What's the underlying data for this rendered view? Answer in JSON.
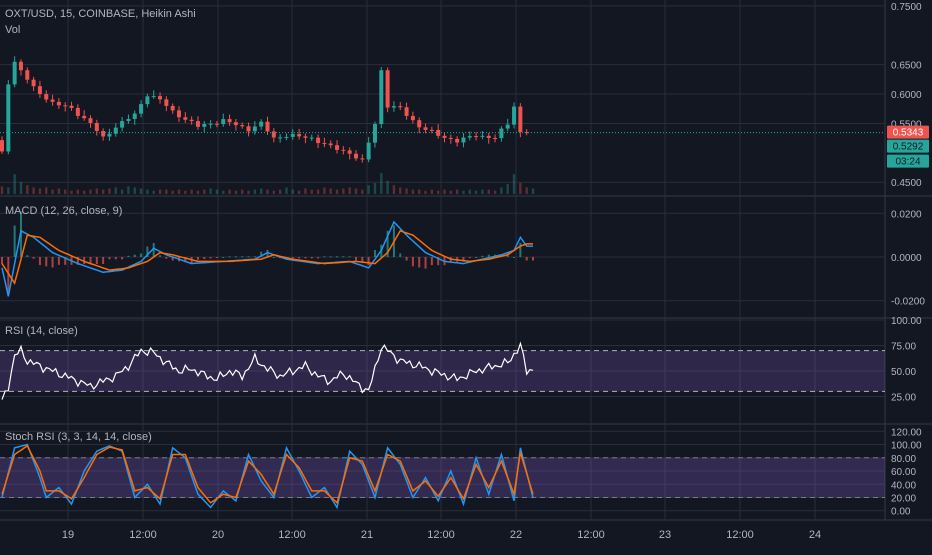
{
  "header": {
    "symbol": "OXT/USD",
    "interval": "15",
    "exchange": "COINBASE",
    "chart_style": "Heikin Ashi",
    "volume_label": "Vol"
  },
  "time_axis": {
    "labels": [
      "19",
      "12:00",
      "20",
      "12:00",
      "21",
      "12:00",
      "22",
      "12:00",
      "23",
      "12:00",
      "24"
    ]
  },
  "price_badges": {
    "last_price": "0.5343",
    "open_price": "0.5292",
    "countdown": "03:24"
  },
  "colors": {
    "background": "#131722",
    "grid": "#2a2e39",
    "up": "#26a69a",
    "down": "#ef5350",
    "macd_line": "#2196f3",
    "signal_line": "#ff6d00",
    "rsi_line": "#ffffff",
    "rsi_band": "#7e57c2",
    "stoch_k": "#2196f3",
    "stoch_d": "#ff6d00"
  },
  "chart_data": [
    {
      "type": "candlestick",
      "title": "OXT/USD, 15, COINBASE, Heikin Ashi",
      "ylim": [
        0.43,
        0.76
      ],
      "y_ticks": [
        "0.7500",
        "0.6500",
        "0.6000",
        "0.5500",
        "0.4500"
      ],
      "last_price": 0.5343,
      "price_path": [
        [
          0,
          0.52
        ],
        [
          1,
          0.5
        ],
        [
          2,
          0.62
        ],
        [
          3,
          0.655
        ],
        [
          4,
          0.64
        ],
        [
          6,
          0.61
        ],
        [
          9,
          0.585
        ],
        [
          12,
          0.575
        ],
        [
          15,
          0.55
        ],
        [
          17,
          0.525
        ],
        [
          19,
          0.545
        ],
        [
          22,
          0.565
        ],
        [
          24,
          0.6
        ],
        [
          26,
          0.59
        ],
        [
          28,
          0.57
        ],
        [
          32,
          0.545
        ],
        [
          36,
          0.555
        ],
        [
          40,
          0.54
        ],
        [
          42,
          0.55
        ],
        [
          44,
          0.525
        ],
        [
          46,
          0.53
        ],
        [
          50,
          0.525
        ],
        [
          53,
          0.51
        ],
        [
          56,
          0.5
        ],
        [
          58,
          0.485
        ],
        [
          60,
          0.55
        ],
        [
          61,
          0.64
        ],
        [
          62,
          0.58
        ],
        [
          64,
          0.575
        ],
        [
          67,
          0.545
        ],
        [
          70,
          0.53
        ],
        [
          73,
          0.52
        ],
        [
          76,
          0.53
        ],
        [
          79,
          0.525
        ],
        [
          81,
          0.55
        ],
        [
          82,
          0.58
        ],
        [
          83,
          0.535
        ],
        [
          84,
          0.537
        ]
      ],
      "volume": [
        0.35,
        0.3,
        0.9,
        0.55,
        0.4,
        0.3,
        0.25,
        0.3,
        0.2,
        0.25,
        0.2,
        0.15,
        0.2,
        0.15,
        0.2,
        0.25,
        0.2,
        0.25,
        0.3,
        0.2,
        0.35,
        0.3,
        0.25,
        0.2,
        0.15,
        0.2,
        0.2,
        0.15,
        0.2,
        0.15,
        0.2,
        0.15,
        0.2,
        0.25,
        0.2,
        0.15,
        0.2,
        0.15,
        0.2,
        0.15,
        0.2,
        0.25,
        0.2,
        0.15,
        0.2,
        0.3,
        0.2,
        0.15,
        0.25,
        0.2,
        0.2,
        0.3,
        0.25,
        0.2,
        0.25,
        0.3,
        0.25,
        0.2,
        0.4,
        0.5,
        0.95,
        0.6,
        0.4,
        0.3,
        0.25,
        0.2,
        0.2,
        0.15,
        0.2,
        0.15,
        0.2,
        0.15,
        0.2,
        0.15,
        0.2,
        0.15,
        0.2,
        0.2,
        0.15,
        0.3,
        0.45,
        0.9,
        0.5,
        0.3,
        0.25
      ]
    },
    {
      "type": "line",
      "title": "MACD (12, 26, close, 9)",
      "ylim": [
        -0.027,
        0.027
      ],
      "y_ticks": [
        "0.0200",
        "0.0000",
        "-0.0200"
      ],
      "series": [
        {
          "key": "macd",
          "points": [
            [
              0,
              -0.005
            ],
            [
              1,
              -0.018
            ],
            [
              3,
              0.012
            ],
            [
              5,
              0.009
            ],
            [
              8,
              0.002
            ],
            [
              12,
              -0.003
            ],
            [
              16,
              -0.007
            ],
            [
              19,
              -0.006
            ],
            [
              22,
              -0.002
            ],
            [
              24,
              0.004
            ],
            [
              26,
              0.001
            ],
            [
              30,
              -0.003
            ],
            [
              35,
              -0.002
            ],
            [
              40,
              -0.001
            ],
            [
              42,
              0.002
            ],
            [
              45,
              -0.001
            ],
            [
              50,
              -0.003
            ],
            [
              55,
              -0.002
            ],
            [
              58,
              -0.005
            ],
            [
              60,
              0.003
            ],
            [
              62,
              0.016
            ],
            [
              64,
              0.01
            ],
            [
              67,
              0.002
            ],
            [
              70,
              -0.002
            ],
            [
              73,
              -0.003
            ],
            [
              76,
              -0.001
            ],
            [
              79,
              0.001
            ],
            [
              81,
              0.003
            ],
            [
              82,
              0.009
            ],
            [
              83,
              0.005
            ],
            [
              84,
              0.005
            ]
          ]
        },
        {
          "key": "signal",
          "points": [
            [
              0,
              -0.003
            ],
            [
              2,
              -0.012
            ],
            [
              4,
              0.01
            ],
            [
              6,
              0.009
            ],
            [
              9,
              0.003
            ],
            [
              13,
              -0.002
            ],
            [
              17,
              -0.006
            ],
            [
              20,
              -0.005
            ],
            [
              23,
              -0.002
            ],
            [
              25,
              0.002
            ],
            [
              27,
              0.001
            ],
            [
              31,
              -0.002
            ],
            [
              36,
              -0.002
            ],
            [
              41,
              -0.001
            ],
            [
              43,
              0.001
            ],
            [
              46,
              -0.001
            ],
            [
              51,
              -0.003
            ],
            [
              56,
              -0.002
            ],
            [
              59,
              -0.003
            ],
            [
              61,
              0.002
            ],
            [
              63,
              0.012
            ],
            [
              65,
              0.01
            ],
            [
              68,
              0.003
            ],
            [
              71,
              -0.001
            ],
            [
              74,
              -0.002
            ],
            [
              77,
              -0.001
            ],
            [
              80,
              0.001
            ],
            [
              82,
              0.005
            ],
            [
              83,
              0.006
            ],
            [
              84,
              0.006
            ]
          ]
        }
      ]
    },
    {
      "type": "line",
      "title": "RSI (14, close)",
      "ylim": [
        0,
        100
      ],
      "y_ticks": [
        "100.00",
        "75.00",
        "50.00",
        "25.00"
      ],
      "band": [
        30,
        70
      ],
      "points": [
        [
          0,
          20
        ],
        [
          1,
          35
        ],
        [
          2,
          65
        ],
        [
          3,
          70
        ],
        [
          4,
          60
        ],
        [
          6,
          55
        ],
        [
          8,
          50
        ],
        [
          10,
          45
        ],
        [
          12,
          40
        ],
        [
          14,
          35
        ],
        [
          16,
          40
        ],
        [
          18,
          45
        ],
        [
          20,
          55
        ],
        [
          22,
          70
        ],
        [
          24,
          68
        ],
        [
          26,
          58
        ],
        [
          28,
          50
        ],
        [
          30,
          52
        ],
        [
          32,
          46
        ],
        [
          34,
          42
        ],
        [
          36,
          50
        ],
        [
          38,
          45
        ],
        [
          40,
          62
        ],
        [
          42,
          52
        ],
        [
          44,
          45
        ],
        [
          46,
          50
        ],
        [
          48,
          55
        ],
        [
          50,
          45
        ],
        [
          52,
          40
        ],
        [
          54,
          48
        ],
        [
          56,
          38
        ],
        [
          58,
          30
        ],
        [
          60,
          74
        ],
        [
          61,
          70
        ],
        [
          63,
          60
        ],
        [
          66,
          55
        ],
        [
          69,
          48
        ],
        [
          72,
          42
        ],
        [
          75,
          50
        ],
        [
          78,
          55
        ],
        [
          80,
          58
        ],
        [
          82,
          75
        ],
        [
          83,
          50
        ],
        [
          84,
          52
        ]
      ]
    },
    {
      "type": "line",
      "title": "Stoch RSI (3, 3, 14, 14, close)",
      "ylim": [
        -14,
        128
      ],
      "y_ticks": [
        "120.00",
        "100.00",
        "80.00",
        "60.00",
        "40.00",
        "20.00",
        "0.00"
      ],
      "band": [
        20,
        80
      ],
      "series": [
        {
          "key": "k",
          "points": [
            [
              0,
              20
            ],
            [
              2,
              95
            ],
            [
              4,
              100
            ],
            [
              6,
              50
            ],
            [
              7,
              20
            ],
            [
              9,
              35
            ],
            [
              11,
              10
            ],
            [
              13,
              60
            ],
            [
              15,
              90
            ],
            [
              17,
              98
            ],
            [
              19,
              90
            ],
            [
              21,
              20
            ],
            [
              23,
              40
            ],
            [
              25,
              10
            ],
            [
              27,
              95
            ],
            [
              29,
              80
            ],
            [
              31,
              25
            ],
            [
              33,
              5
            ],
            [
              35,
              30
            ],
            [
              37,
              15
            ],
            [
              39,
              85
            ],
            [
              41,
              45
            ],
            [
              43,
              20
            ],
            [
              45,
              95
            ],
            [
              47,
              60
            ],
            [
              49,
              20
            ],
            [
              51,
              35
            ],
            [
              53,
              5
            ],
            [
              55,
              90
            ],
            [
              57,
              70
            ],
            [
              59,
              20
            ],
            [
              61,
              95
            ],
            [
              63,
              70
            ],
            [
              65,
              20
            ],
            [
              67,
              50
            ],
            [
              69,
              15
            ],
            [
              71,
              60
            ],
            [
              73,
              10
            ],
            [
              75,
              80
            ],
            [
              77,
              25
            ],
            [
              79,
              85
            ],
            [
              81,
              15
            ],
            [
              82,
              95
            ],
            [
              84,
              20
            ]
          ]
        },
        {
          "key": "d",
          "points": [
            [
              0,
              25
            ],
            [
              2,
              85
            ],
            [
              4,
              98
            ],
            [
              6,
              60
            ],
            [
              7,
              30
            ],
            [
              9,
              30
            ],
            [
              11,
              18
            ],
            [
              13,
              50
            ],
            [
              15,
              85
            ],
            [
              17,
              96
            ],
            [
              19,
              92
            ],
            [
              21,
              30
            ],
            [
              23,
              35
            ],
            [
              25,
              18
            ],
            [
              27,
              85
            ],
            [
              29,
              85
            ],
            [
              31,
              35
            ],
            [
              33,
              12
            ],
            [
              35,
              25
            ],
            [
              37,
              20
            ],
            [
              39,
              75
            ],
            [
              41,
              55
            ],
            [
              43,
              25
            ],
            [
              45,
              85
            ],
            [
              47,
              65
            ],
            [
              49,
              30
            ],
            [
              51,
              30
            ],
            [
              53,
              12
            ],
            [
              55,
              80
            ],
            [
              57,
              75
            ],
            [
              59,
              30
            ],
            [
              61,
              85
            ],
            [
              63,
              75
            ],
            [
              65,
              30
            ],
            [
              67,
              45
            ],
            [
              69,
              22
            ],
            [
              71,
              50
            ],
            [
              73,
              18
            ],
            [
              75,
              70
            ],
            [
              77,
              35
            ],
            [
              79,
              75
            ],
            [
              81,
              25
            ],
            [
              82,
              88
            ],
            [
              84,
              25
            ]
          ]
        }
      ]
    }
  ]
}
